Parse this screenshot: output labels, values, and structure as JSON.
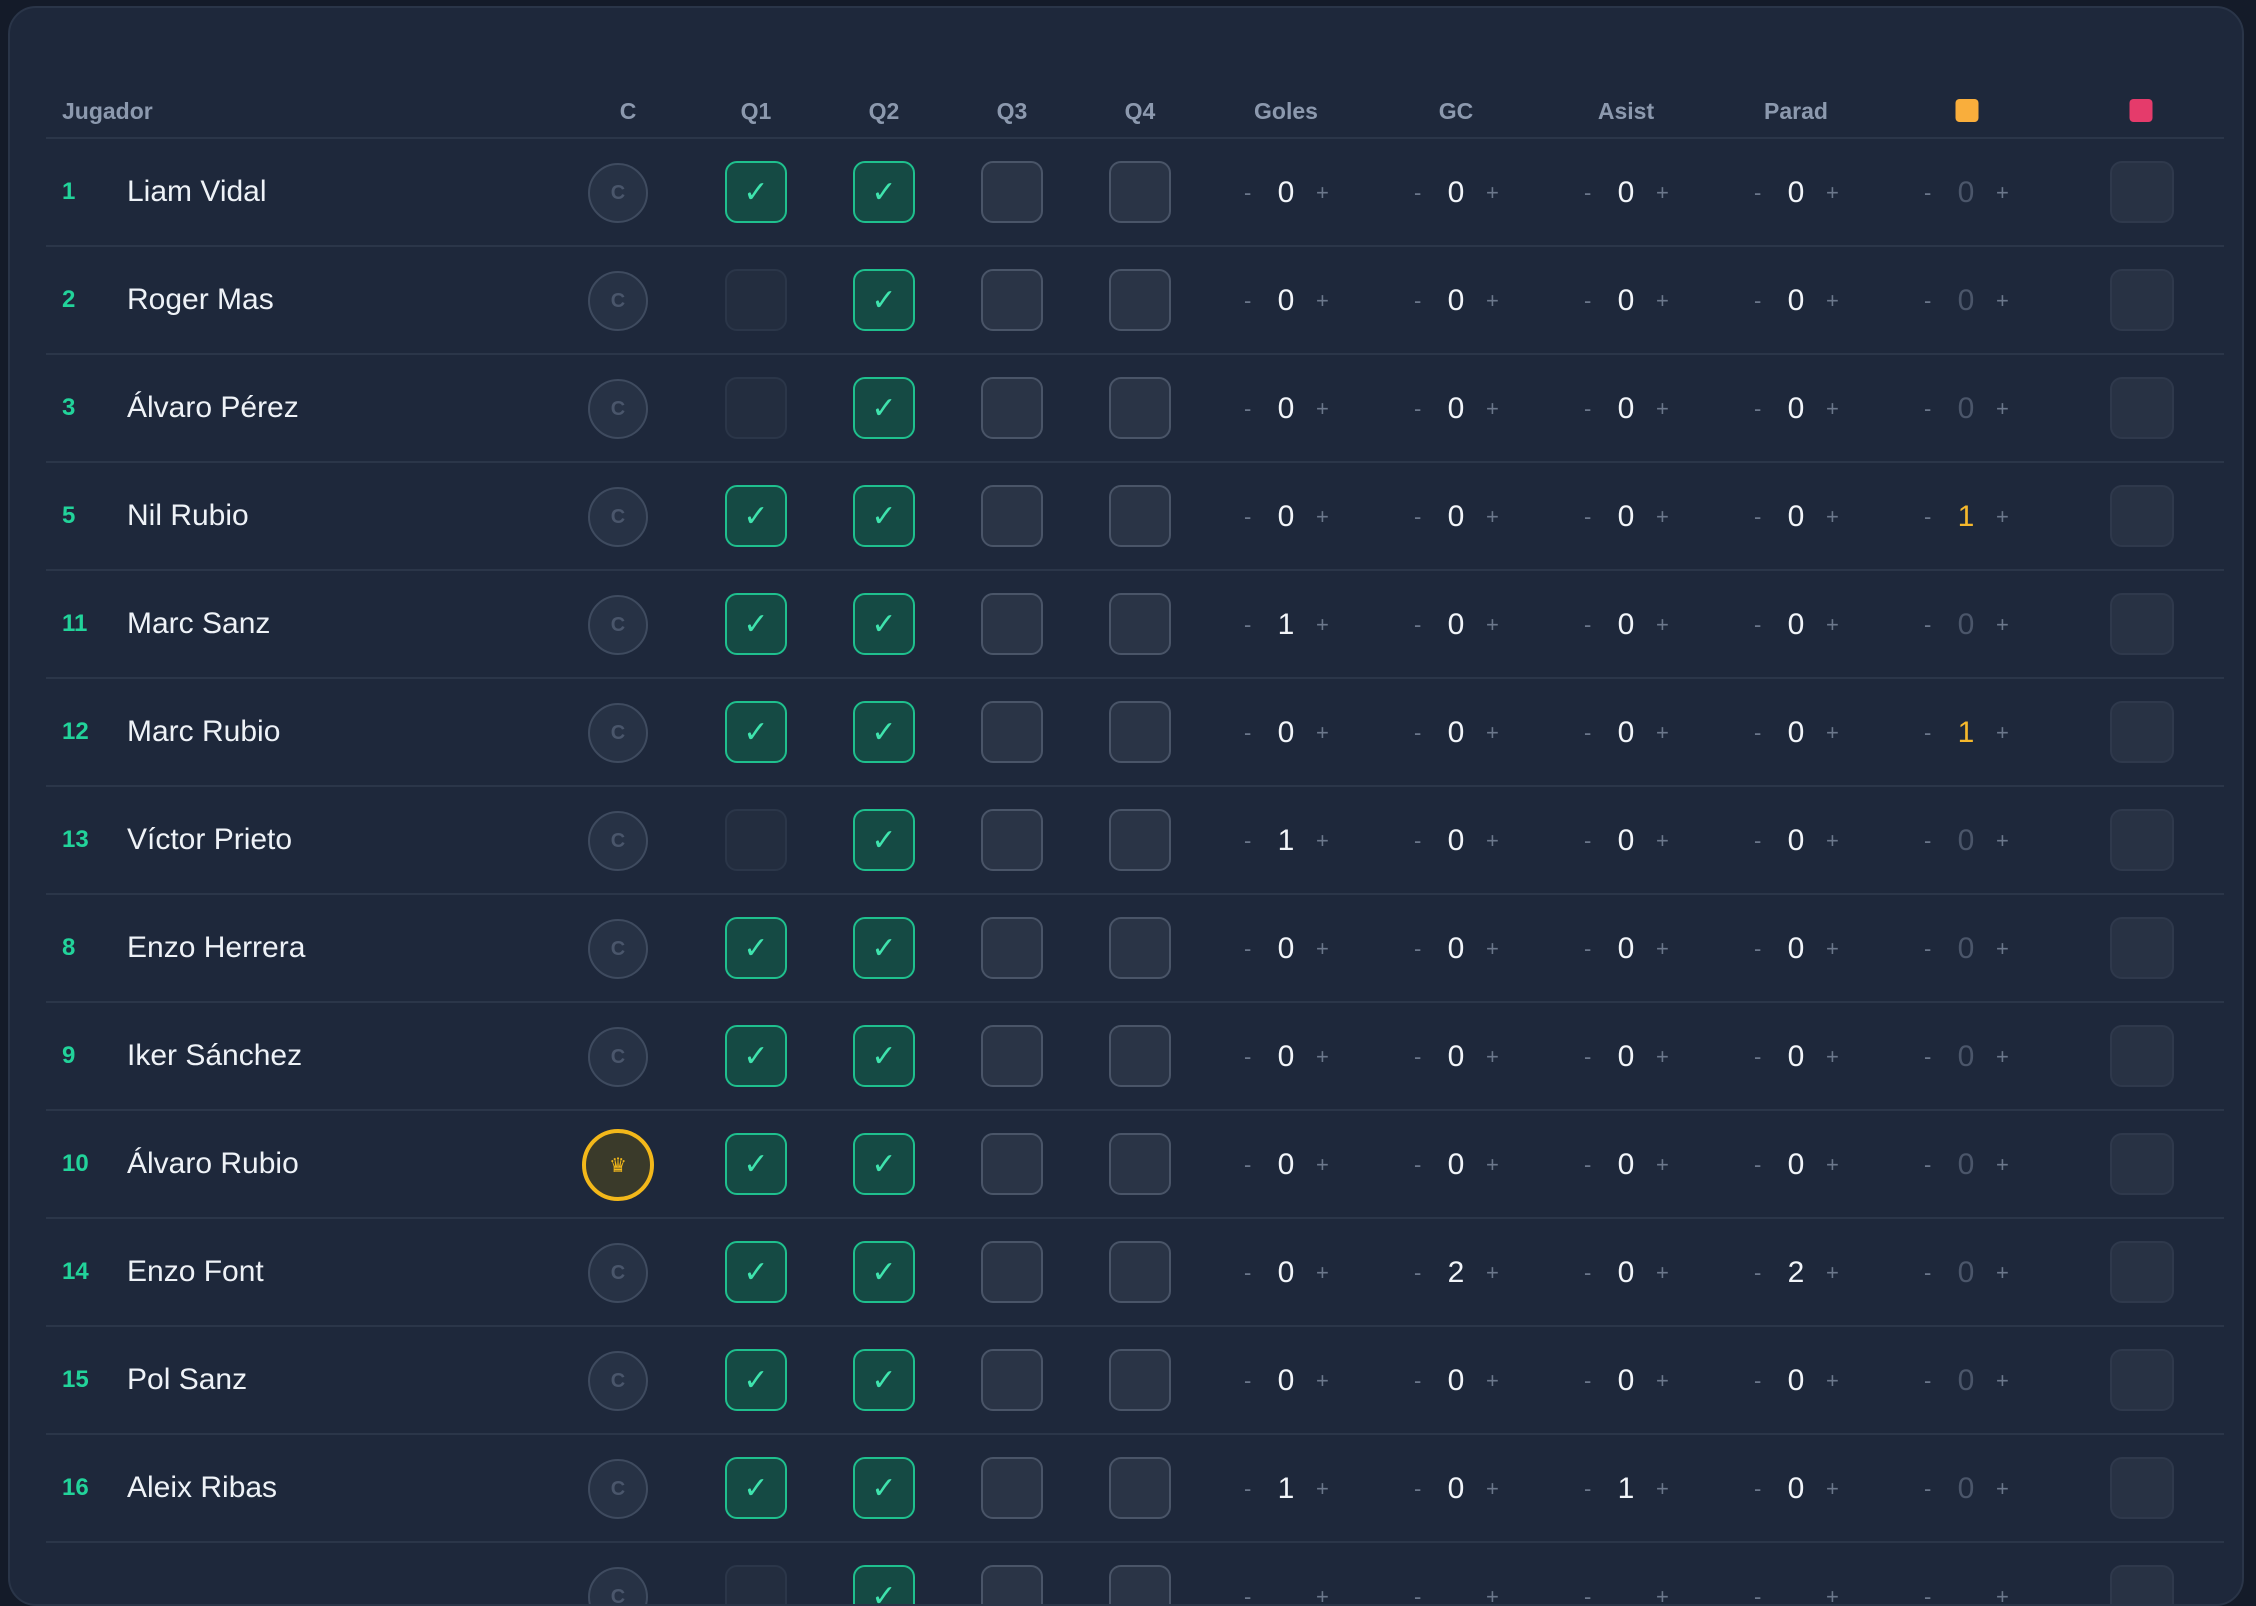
{
  "header": {
    "jugador": "Jugador",
    "c": "C",
    "q1": "Q1",
    "q2": "Q2",
    "q3": "Q3",
    "q4": "Q4",
    "goles": "Goles",
    "gc": "GC",
    "asist": "Asist",
    "parad": "Parad",
    "yellow_card_color": "#f9ae3c",
    "red_card_color": "#e53b6b"
  },
  "controls": {
    "minus": "-",
    "plus": "+",
    "captain_placeholder": "C",
    "captain_icon": "crown-icon",
    "check": "✓"
  },
  "players": [
    {
      "number": "1",
      "name": "Liam Vidal",
      "captain": false,
      "q": [
        true,
        true,
        false,
        false
      ],
      "q_dim": [
        false,
        false,
        false,
        false
      ],
      "goles": "0",
      "gc": "0",
      "asist": "0",
      "parad": "0",
      "amarillas": "0"
    },
    {
      "number": "2",
      "name": "Roger Mas",
      "captain": false,
      "q": [
        false,
        true,
        false,
        false
      ],
      "q_dim": [
        true,
        false,
        false,
        false
      ],
      "goles": "0",
      "gc": "0",
      "asist": "0",
      "parad": "0",
      "amarillas": "0"
    },
    {
      "number": "3",
      "name": "Álvaro Pérez",
      "captain": false,
      "q": [
        false,
        true,
        false,
        false
      ],
      "q_dim": [
        true,
        false,
        false,
        false
      ],
      "goles": "0",
      "gc": "0",
      "asist": "0",
      "parad": "0",
      "amarillas": "0"
    },
    {
      "number": "5",
      "name": "Nil Rubio",
      "captain": false,
      "q": [
        true,
        true,
        false,
        false
      ],
      "q_dim": [
        false,
        false,
        false,
        false
      ],
      "goles": "0",
      "gc": "0",
      "asist": "0",
      "parad": "0",
      "amarillas": "1"
    },
    {
      "number": "11",
      "name": "Marc Sanz",
      "captain": false,
      "q": [
        true,
        true,
        false,
        false
      ],
      "q_dim": [
        false,
        false,
        false,
        false
      ],
      "goles": "1",
      "gc": "0",
      "asist": "0",
      "parad": "0",
      "amarillas": "0"
    },
    {
      "number": "12",
      "name": "Marc Rubio",
      "captain": false,
      "q": [
        true,
        true,
        false,
        false
      ],
      "q_dim": [
        false,
        false,
        false,
        false
      ],
      "goles": "0",
      "gc": "0",
      "asist": "0",
      "parad": "0",
      "amarillas": "1"
    },
    {
      "number": "13",
      "name": "Víctor Prieto",
      "captain": false,
      "q": [
        false,
        true,
        false,
        false
      ],
      "q_dim": [
        true,
        false,
        false,
        false
      ],
      "goles": "1",
      "gc": "0",
      "asist": "0",
      "parad": "0",
      "amarillas": "0"
    },
    {
      "number": "8",
      "name": "Enzo Herrera",
      "captain": false,
      "q": [
        true,
        true,
        false,
        false
      ],
      "q_dim": [
        false,
        false,
        false,
        false
      ],
      "goles": "0",
      "gc": "0",
      "asist": "0",
      "parad": "0",
      "amarillas": "0"
    },
    {
      "number": "9",
      "name": "Iker Sánchez",
      "captain": false,
      "q": [
        true,
        true,
        false,
        false
      ],
      "q_dim": [
        false,
        false,
        false,
        false
      ],
      "goles": "0",
      "gc": "0",
      "asist": "0",
      "parad": "0",
      "amarillas": "0"
    },
    {
      "number": "10",
      "name": "Álvaro Rubio",
      "captain": true,
      "q": [
        true,
        true,
        false,
        false
      ],
      "q_dim": [
        false,
        false,
        false,
        false
      ],
      "goles": "0",
      "gc": "0",
      "asist": "0",
      "parad": "0",
      "amarillas": "0"
    },
    {
      "number": "14",
      "name": "Enzo Font",
      "captain": false,
      "q": [
        true,
        true,
        false,
        false
      ],
      "q_dim": [
        false,
        false,
        false,
        false
      ],
      "goles": "0",
      "gc": "2",
      "asist": "0",
      "parad": "2",
      "amarillas": "0"
    },
    {
      "number": "15",
      "name": "Pol Sanz",
      "captain": false,
      "q": [
        true,
        true,
        false,
        false
      ],
      "q_dim": [
        false,
        false,
        false,
        false
      ],
      "goles": "0",
      "gc": "0",
      "asist": "0",
      "parad": "0",
      "amarillas": "0"
    },
    {
      "number": "16",
      "name": "Aleix Ribas",
      "captain": false,
      "q": [
        true,
        true,
        false,
        false
      ],
      "q_dim": [
        false,
        false,
        false,
        false
      ],
      "goles": "1",
      "gc": "0",
      "asist": "1",
      "parad": "0",
      "amarillas": "0"
    },
    {
      "number": "",
      "name": "",
      "captain": false,
      "q": [
        false,
        true,
        false,
        false
      ],
      "q_dim": [
        true,
        false,
        false,
        false
      ],
      "goles": "",
      "gc": "",
      "asist": "",
      "parad": "",
      "amarillas": ""
    }
  ]
}
